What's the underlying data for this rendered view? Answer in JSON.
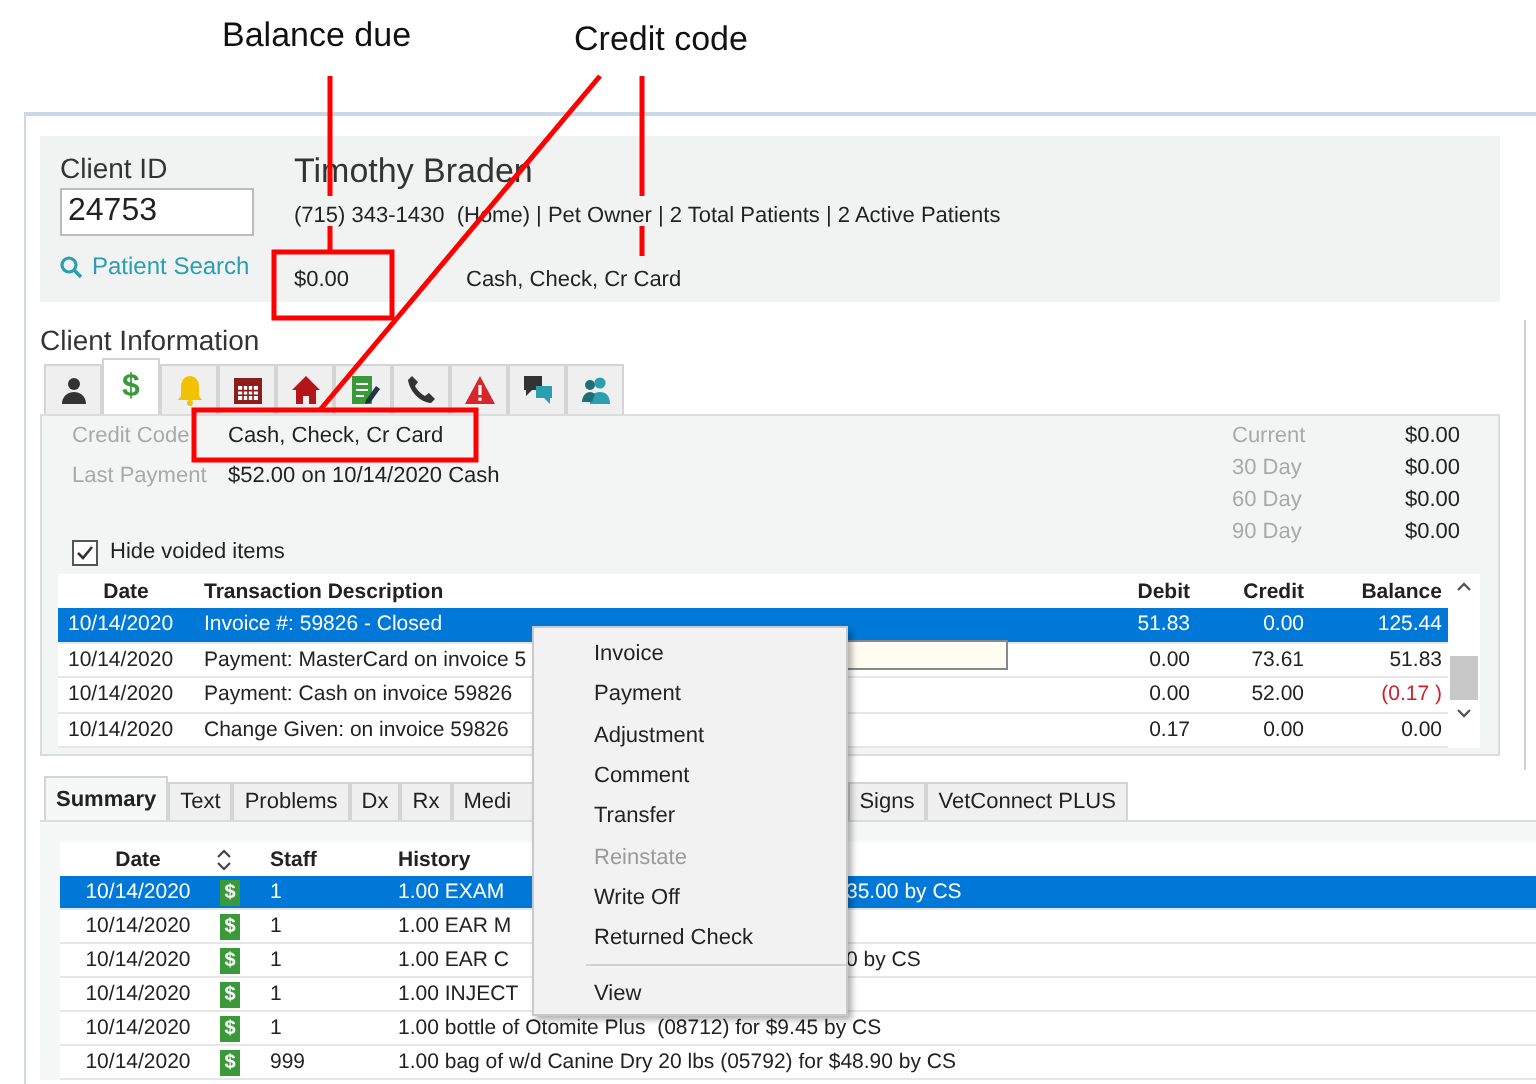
{
  "annotations": [
    {
      "label": "Balance due"
    },
    {
      "label": "Credit code"
    }
  ],
  "client": {
    "id_label": "Client ID",
    "id_value": "24753",
    "patient_search": "Patient Search",
    "name": "Timothy Braden",
    "details": "(715) 343-1430  (Home) | Pet Owner | 2 Total Patients | 2 Active Patients",
    "balance": "$0.00",
    "credit_code": "Cash, Check, Cr Card"
  },
  "section_title": "Client Information",
  "icon_tabs": [
    {
      "kind": "person",
      "selected": false
    },
    {
      "kind": "glyph",
      "glyph": "$",
      "selected": true
    },
    {
      "kind": "bell",
      "selected": false
    },
    {
      "kind": "calendar",
      "selected": false
    },
    {
      "kind": "house",
      "selected": false
    },
    {
      "kind": "notes",
      "selected": false
    },
    {
      "kind": "phone",
      "selected": false
    },
    {
      "kind": "warning",
      "selected": false
    },
    {
      "kind": "chat",
      "selected": false
    },
    {
      "kind": "people",
      "selected": false
    }
  ],
  "account": {
    "info": [
      {
        "label": "Credit Code",
        "value": "Cash, Check, Cr Card"
      },
      {
        "label": "Last Payment",
        "value": "$52.00 on 10/14/2020 Cash"
      }
    ],
    "aging": [
      {
        "label": "Current",
        "value": "$0.00"
      },
      {
        "label": "30 Day",
        "value": "$0.00"
      },
      {
        "label": "60 Day",
        "value": "$0.00"
      },
      {
        "label": "90 Day",
        "value": "$0.00"
      }
    ],
    "hide_voided": {
      "label": "Hide voided items",
      "checked": true
    },
    "columns": [
      "Date",
      "Transaction Description",
      "Debit",
      "Credit",
      "Balance"
    ],
    "rows": [
      {
        "date": "10/14/2020",
        "description": "Invoice #: 59826 - Closed",
        "debit": "51.83",
        "credit": "0.00",
        "balance": "125.44",
        "negative": false,
        "selected": true
      },
      {
        "date": "10/14/2020",
        "description": "Payment: MasterCard on invoice 5",
        "debit": "0.00",
        "credit": "73.61",
        "balance": "51.83",
        "negative": false,
        "selected": false
      },
      {
        "date": "10/14/2020",
        "description": "Payment: Cash on invoice 59826",
        "debit": "0.00",
        "credit": "52.00",
        "balance": "(0.17 )",
        "negative": true,
        "selected": false
      },
      {
        "date": "10/14/2020",
        "description": "Change Given: on invoice 59826",
        "debit": "0.17",
        "credit": "0.00",
        "balance": "0.00",
        "negative": false,
        "selected": false
      }
    ]
  },
  "detail_tabs": [
    {
      "label": "Summary",
      "selected": true
    },
    {
      "label": "Text",
      "selected": false
    },
    {
      "label": "Problems",
      "selected": false
    },
    {
      "label": "Dx",
      "selected": false
    },
    {
      "label": "Rx",
      "selected": false
    },
    {
      "label": "Medi",
      "selected": false
    },
    {
      "label": "Signs",
      "selected": false
    },
    {
      "label": "VetConnect PLUS",
      "selected": false
    }
  ],
  "history": {
    "columns": [
      "Date",
      "Staff",
      "History"
    ],
    "rows": [
      {
        "date": "10/14/2020",
        "glyph": "$",
        "staff": "1",
        "history_start": "1.00 EXAM",
        "history_end": "35.00 by CS",
        "selected": true
      },
      {
        "date": "10/14/2020",
        "glyph": "$",
        "staff": "1",
        "history_start": "1.00 EAR M",
        "selected": false
      },
      {
        "date": "10/14/2020",
        "glyph": "$",
        "staff": "1",
        "history_start": "1.00 EAR C",
        "history_end": "0 by CS",
        "selected": false
      },
      {
        "date": "10/14/2020",
        "glyph": "$",
        "staff": "1",
        "history_start": "1.00 INJECT",
        "selected": false
      },
      {
        "date": "10/14/2020",
        "glyph": "$",
        "staff": "1",
        "history_start": "1.00 bottle of Otomite Plus  (08712) for $9.45 by CS",
        "selected": false
      },
      {
        "date": "10/14/2020",
        "glyph": "$",
        "staff": "999",
        "history_start": "1.00 bag of w/d Canine Dry 20 lbs (05792) for $48.90 by CS",
        "selected": false
      }
    ]
  },
  "context_menu": [
    {
      "kind": "item",
      "label": "Invoice",
      "disabled": false
    },
    {
      "kind": "item",
      "label": "Payment",
      "disabled": false
    },
    {
      "kind": "item",
      "label": "Adjustment",
      "disabled": false
    },
    {
      "kind": "item",
      "label": "Comment",
      "disabled": false
    },
    {
      "kind": "item",
      "label": "Transfer",
      "disabled": false
    },
    {
      "kind": "item",
      "label": "Reinstate",
      "disabled": true
    },
    {
      "kind": "item",
      "label": "Write Off",
      "disabled": false
    },
    {
      "kind": "item",
      "label": "Returned Check",
      "disabled": false
    },
    {
      "kind": "separator"
    },
    {
      "kind": "item",
      "label": "View",
      "disabled": false
    }
  ]
}
